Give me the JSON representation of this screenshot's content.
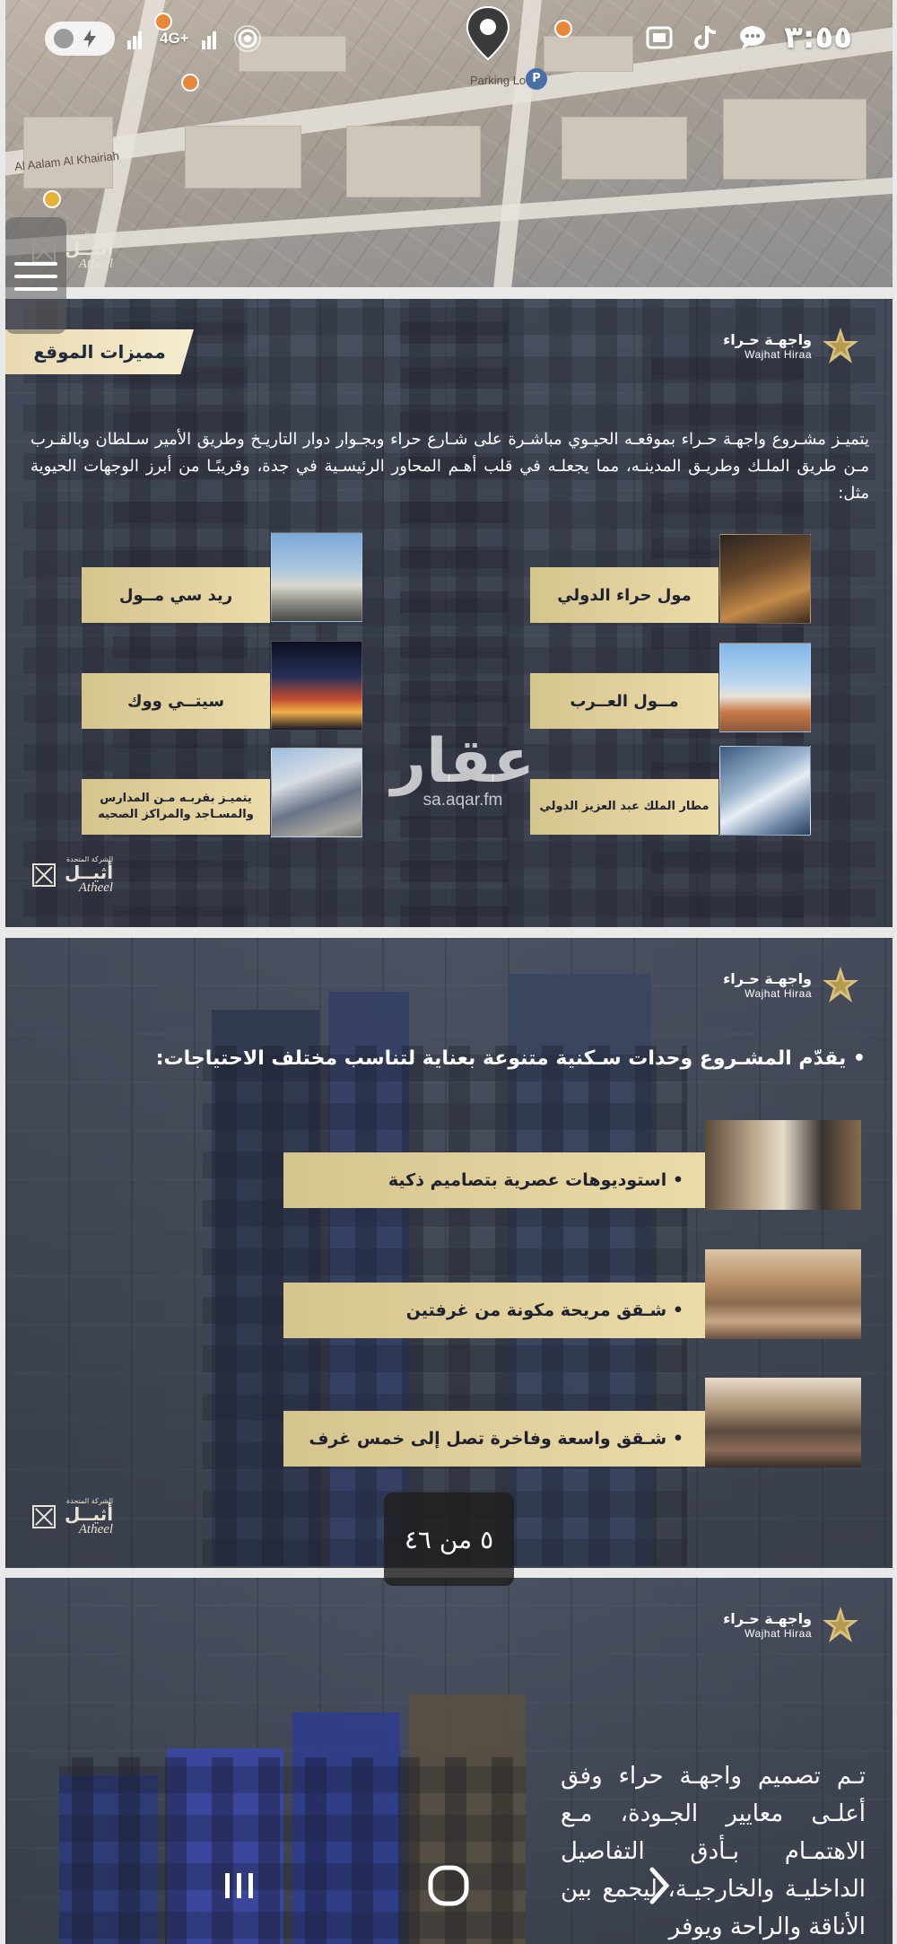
{
  "status_bar": {
    "clock": "٣:٥٥",
    "network": "4G+"
  },
  "map": {
    "parking_label": "Parking Lot",
    "street_label": "Al Aalam Al Khairiah"
  },
  "slide_location": {
    "section_title": "مميزات الموقع",
    "logo_ar": "واجهـة حـراء",
    "logo_en": "Wajhat Hiraa",
    "paragraph": "يتميـز مشـروع واجهـة حـراء بموقعـه الحيـوي مباشـرة على شـارع حراء وبجـوار دوار التاريـخ وطريق الأمير سـلطان وبالقـرب مـن طريق الملـك وطريـق المدينـه، مما يجعلـه في قلب أهـم المحاور الرئيسـية في جدة، وقريبًـا من أبرز الوجهات الحيوية مثل:",
    "places": [
      {
        "label": "مول حراء الدولي"
      },
      {
        "label": "ريد سي مــول"
      },
      {
        "label": "مــول العــرب"
      },
      {
        "label": "سيتــي ووك"
      },
      {
        "label": "مطار الملك عبد العزيز الدولي"
      },
      {
        "label": "يتميـز بقربـه مـن المدارس والمسـاجد والمراكز الصحيه"
      }
    ],
    "watermark_big": "عقار",
    "watermark_small": "sa.aqar.fm",
    "developer_small": "الشركة المتحدة",
    "developer_ar": "أثيــل",
    "developer_en": "Atheel"
  },
  "slide_units": {
    "logo_ar": "واجهـة حـراء",
    "logo_en": "Wajhat Hiraa",
    "headline": "• يقدّم المشـروع وحدات سـكنية متنوعة بعناية لتناسب مختلف الاحتياجات:",
    "bars": [
      {
        "label": "•  استوديوهات عصرية بتصاميم ذكية"
      },
      {
        "label": "•  شـقق مريحة مكونة من غرفتين"
      },
      {
        "label": "•  شـقق واسعة وفاخرة تصل إلى خمس غرف"
      }
    ],
    "developer_small": "الشركة المتحدة",
    "developer_ar": "أثيــل",
    "developer_en": "Atheel"
  },
  "pager": {
    "label": "٥ من ٤٦"
  },
  "slide_design": {
    "logo_ar": "واجهـة حـراء",
    "logo_en": "Wajhat Hiraa",
    "text": "تـم تصميم واجهـة حراء وفق أعلـى معايير الجـودة، مـع الاهتمـام بـأدق التفاصيل الداخليـة والخارجيـة، ليجمع بين الأناقة والراحة ويوفر"
  },
  "colors": {
    "gold": "#d6c48e",
    "navy": "#1f2330",
    "slate": "#4d5362"
  }
}
